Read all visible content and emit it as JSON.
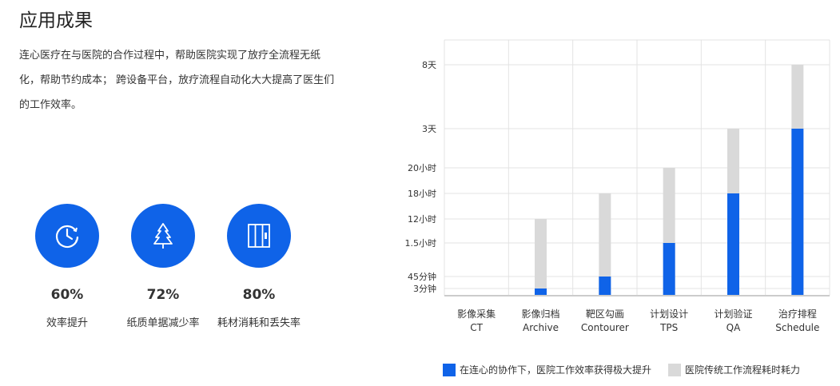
{
  "section": {
    "title": "应用成果",
    "description": "连心医疗在与医院的合作过程中，帮助医院实现了放疗全流程无纸化，帮助节约成本； 跨设备平台，放疗流程自动化大大提高了医生们的工作效率。"
  },
  "metrics": [
    {
      "icon": "clock-icon",
      "value": "60%",
      "label": "效率提升"
    },
    {
      "icon": "tree-icon",
      "value": "72%",
      "label": "纸质单据减少率"
    },
    {
      "icon": "cabinet-icon",
      "value": "80%",
      "label": "耗材消耗和丢失率"
    }
  ],
  "colors": {
    "accent": "#0f63e8",
    "legacy": "#d9d9d9",
    "grid": "#e3e3e3"
  },
  "chart_data": {
    "type": "bar",
    "stacked": true,
    "categories": [
      [
        "影像采集",
        "CT"
      ],
      [
        "影像归档",
        "Archive"
      ],
      [
        "靶区勾画",
        "Contourer"
      ],
      [
        "计划设计",
        "TPS"
      ],
      [
        "计划验证",
        "QA"
      ],
      [
        "治疗排程",
        "Schedule"
      ]
    ],
    "y_ticks": [
      "3分钟",
      "45分钟",
      "1.5小时",
      "12小时",
      "18小时",
      "20小时",
      "3天",
      "8天"
    ],
    "y_scale": "ordinal tick labels; positions read against labelled ticks",
    "series": [
      {
        "name": "在连心的协作下，医院工作效率获得极大提升",
        "color": "#0f63e8",
        "values": [
          "0",
          "3分钟",
          "45分钟",
          "1.5小时",
          "18小时",
          "3天"
        ]
      },
      {
        "name": "医院传统工作流程耗时耗力",
        "color": "#d9d9d9",
        "values": [
          "0",
          "12小时",
          "18小时",
          "20小时",
          "3天",
          "8天"
        ]
      }
    ],
    "grid": true,
    "legend_position": "bottom"
  }
}
